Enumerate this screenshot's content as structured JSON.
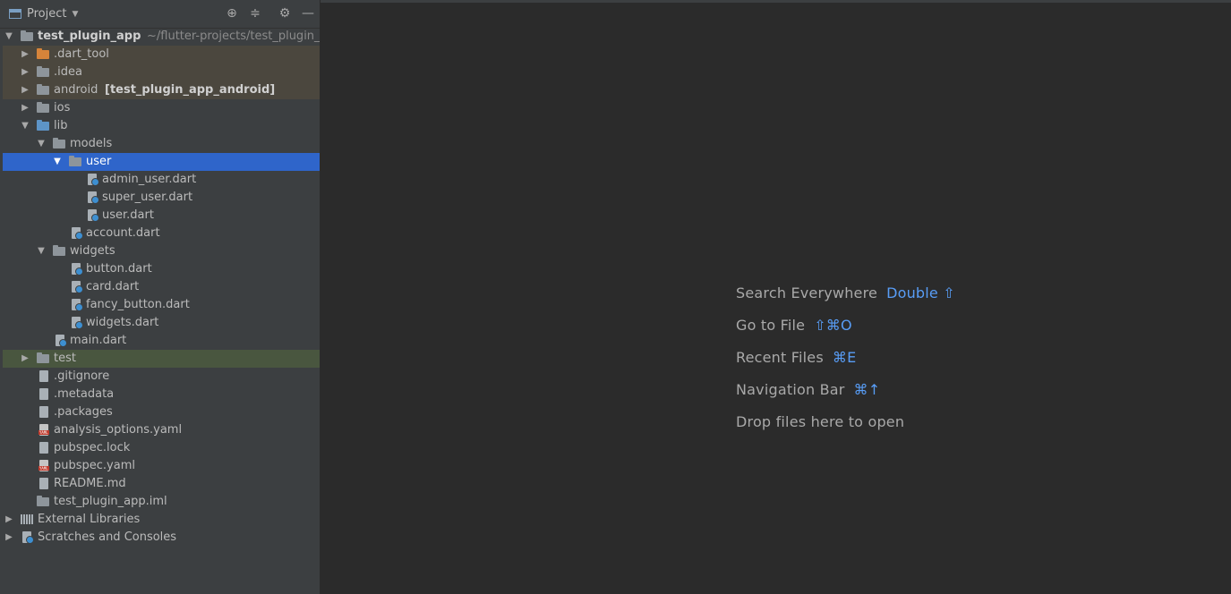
{
  "panel": {
    "title": "Project",
    "tools": [
      "locate-icon",
      "collapse-icon",
      "gear-icon",
      "minimize-icon"
    ]
  },
  "tree": {
    "root": {
      "name": "test_plugin_app",
      "path": "~/flutter-projects/test_plugin_"
    },
    "dart_tool": ".dart_tool",
    "idea": ".idea",
    "android": {
      "name": "android",
      "module": "[test_plugin_app_android]"
    },
    "ios": "ios",
    "lib": "lib",
    "models": "models",
    "user": "user",
    "admin_user": "admin_user.dart",
    "super_user": "super_user.dart",
    "user_dart": "user.dart",
    "account": "account.dart",
    "widgets": "widgets",
    "button": "button.dart",
    "card": "card.dart",
    "fancy_button": "fancy_button.dart",
    "widgets_dart": "widgets.dart",
    "main": "main.dart",
    "test": "test",
    "gitignore": ".gitignore",
    "metadata": ".metadata",
    "packages": ".packages",
    "analysis": "analysis_options.yaml",
    "pubspec_lock": "pubspec.lock",
    "pubspec_yaml": "pubspec.yaml",
    "readme": "README.md",
    "iml": "test_plugin_app.iml",
    "external": "External Libraries",
    "scratches": "Scratches and Consoles"
  },
  "editor_hints": {
    "search": {
      "label": "Search Everywhere",
      "key": "Double ⇧"
    },
    "goto": {
      "label": "Go to File",
      "key": "⇧⌘O"
    },
    "recent": {
      "label": "Recent Files",
      "key": "⌘E"
    },
    "nav": {
      "label": "Navigation Bar",
      "key": "⌘↑"
    },
    "drop": {
      "label": "Drop files here to open"
    }
  },
  "colors": {
    "selection": "#2f65ca",
    "shortcut": "#589df6",
    "excluded_bg": "#4b473e",
    "test_bg": "#49563f"
  }
}
